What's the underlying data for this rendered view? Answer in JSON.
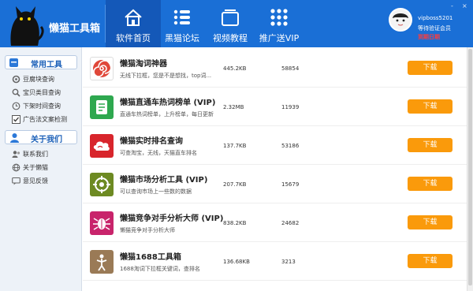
{
  "app": {
    "title": "懒猫工具箱",
    "window_controls": [
      "-",
      "×"
    ],
    "colors": {
      "header": "#1a6fd6",
      "header_active": "#1458b8",
      "download": "#fa9a0b"
    }
  },
  "nav": [
    {
      "label": "软件首页",
      "icon": "home-icon",
      "active": true
    },
    {
      "label": "黑猫论坛",
      "icon": "forum-icon",
      "active": false
    },
    {
      "label": "视频教程",
      "icon": "video-icon",
      "active": false
    },
    {
      "label": "推广送VIP",
      "icon": "apps-icon",
      "active": false
    }
  ],
  "user": {
    "name": "vipboss5201",
    "status": "等待验证会员",
    "note": "到期日期"
  },
  "sidebar": {
    "sections": [
      {
        "title": "常用工具",
        "icon": "tools-icon",
        "items": [
          {
            "label": "豆腐块查询",
            "icon": "gear-icon"
          },
          {
            "label": "宝贝类目查询",
            "icon": "search-icon"
          },
          {
            "label": "下架时间查询",
            "icon": "clock-icon"
          },
          {
            "label": "广告法文案检测",
            "icon": "check-icon"
          }
        ]
      },
      {
        "title": "关于我们",
        "icon": "person-icon",
        "items": [
          {
            "label": "联系我们",
            "icon": "contact-icon"
          },
          {
            "label": "关于懒猫",
            "icon": "globe-icon"
          },
          {
            "label": "意见反馈",
            "icon": "feedback-icon"
          }
        ]
      }
    ]
  },
  "tools": [
    {
      "name": "懒猫淘词神器",
      "desc": "无线下拉框，您是不是想找，top词...",
      "size": "445.2KB",
      "count": "58854",
      "download": "下载",
      "icon": "spiral-icon",
      "color": "#e0483a"
    },
    {
      "name": "懒猫直通车热词榜单 (VIP)",
      "desc": "直通车热词榜单，上升榜单，每日更新",
      "size": "2.32MB",
      "count": "11939",
      "download": "下载",
      "icon": "scroll-icon",
      "color": "#2ea84f"
    },
    {
      "name": "懒猫实时排名查询",
      "desc": "可查淘宝，无线，天猫直车排名",
      "size": "137.7KB",
      "count": "53186",
      "download": "下载",
      "icon": "cloud-icon",
      "color": "#d8252c"
    },
    {
      "name": "懒猫市场分析工具 (VIP)",
      "desc": "可以查询市场上一些数的数据",
      "size": "207.7KB",
      "count": "15679",
      "download": "下载",
      "icon": "target-icon",
      "color": "#6d8a22"
    },
    {
      "name": "懒猫竞争对手分析大师 (VIP)",
      "desc": "懒猫竞争对手分析大师",
      "size": "838.2KB",
      "count": "24682",
      "download": "下载",
      "icon": "bug-icon",
      "color": "#c8246b"
    },
    {
      "name": "懒猫1688工具箱",
      "desc": "1688淘词下拉框关键词，查排名",
      "size": "136.68KB",
      "count": "3213",
      "download": "下载",
      "icon": "figure-icon",
      "color": "#9a7a56"
    }
  ]
}
